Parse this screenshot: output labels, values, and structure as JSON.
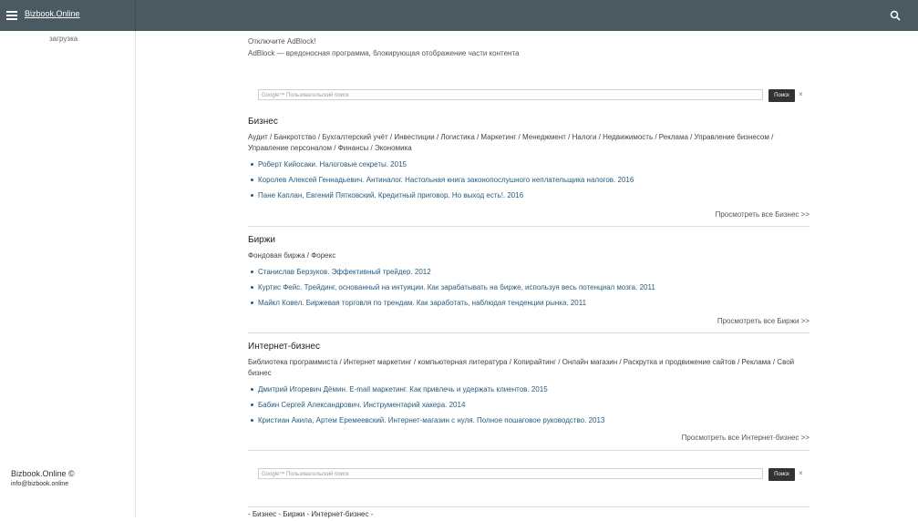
{
  "header": {
    "brand": "Bizbook.Online",
    "menu_icon": "hamburger-icon",
    "search_icon": "search-icon"
  },
  "sidebar": {
    "upload": "загрузка",
    "copyright": "Bizbook.Online ©",
    "email": "info@bizbook.online"
  },
  "notice": {
    "line1": "Отключите AdBlock!",
    "line2": "AdBlock — вредоносная программа, блокирующая отображение части контента"
  },
  "search": {
    "placeholder": "Google™ Пользовательский поиск",
    "button": "Поиск",
    "clear": "×"
  },
  "sections": [
    {
      "title": "Бизнес",
      "categories": "Аудит / Банкротство / Бухгалтерский учёт / Инвестиции / Логистика / Маркетинг / Менеджмент / Налоги / Недвижимость / Реклама / Управление бизнесом / Управление персоналом / Финансы / Экономика",
      "books": [
        "Роберт Кийосаки. Налоговые секреты. 2015",
        "Королев Алексей Геннадьевич. Антиналог. Настольная книга законопослушного неплательщика налогов. 2016",
        "Пане Каплан, Евгений Пятковский. Кредитный приговор. Но выход есть!. 2016"
      ],
      "more": "Просмотреть все Бизнес >>"
    },
    {
      "title": "Биржи",
      "categories": "Фондовая биржа / Форекс",
      "books": [
        "Станислав Берзуков. Эффективный трейдер. 2012",
        "Куртис Фейс. Трейдинг, основанный на интуиции. Как зарабатывать на бирже, используя весь потенциал мозга. 2011",
        "Майкл Ковел. Биржевая торговля по трендам. Как заработать, наблюдая тенденции рынка. 2011"
      ],
      "more": "Просмотреть все Биржи >>"
    },
    {
      "title": "Интернет-бизнес",
      "categories": "Библиотека программиста / Интернет маркетинг / компьютерная литература / Копирайтинг / Онлайн магазин / Раскрутка и продвижение сайтов / Реклама / Свой бизнес",
      "books": [
        "Дмитрий Игоревич Дёмин. E-mail маркетинг. Как привлечь и удержать клиентов. 2015",
        "Бабин Сергей Александрович. Инструментарий хакера. 2014",
        "Кристиан Акила, Артем Еремеевский. Интернет-магазин с нуля. Полное пошаговое руководство. 2013"
      ],
      "more": "Просмотреть все Интернет-бизнес >>"
    }
  ],
  "footer_links": "- Бизнес - Биржи - Интернет-бизнес -"
}
